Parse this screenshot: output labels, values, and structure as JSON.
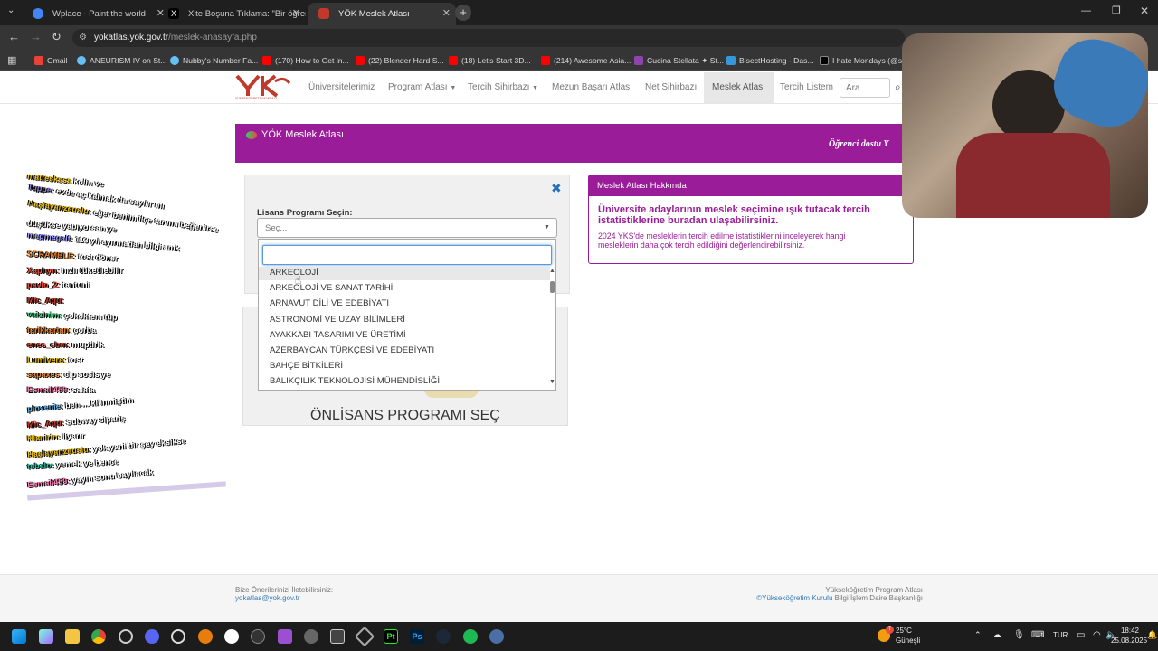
{
  "browser": {
    "tabs": [
      {
        "title": "Wplace - Paint the world",
        "active": false,
        "color": "#4285f4"
      },
      {
        "title": "X'te Boşuna Tıklama: \"Bir öğren",
        "active": false,
        "color": "#000000"
      },
      {
        "title": "YÖK Meslek Atlası",
        "active": true,
        "color": "#c0392b"
      }
    ],
    "url_host": "yokatlas.yok.gov.tr",
    "url_path": "/meslek-anasayfa.php",
    "bookmarks": [
      {
        "label": "Gmail",
        "color": "#ea4335"
      },
      {
        "label": "ANEURISM IV on St...",
        "color": "#1b2838"
      },
      {
        "label": "Nubby's Number Fa...",
        "color": "#1b2838"
      },
      {
        "label": "(170) How to Get in...",
        "color": "#ff0000"
      },
      {
        "label": "(22) Blender Hard S...",
        "color": "#ff0000"
      },
      {
        "label": "(18) Let's Start 3D...",
        "color": "#ff0000"
      },
      {
        "label": "(214) Awesome Asia...",
        "color": "#ff0000"
      },
      {
        "label": "Cucina Stellata ✦ St...",
        "color": "#8e44ad"
      },
      {
        "label": "BisectHosting - Das...",
        "color": "#3498db"
      },
      {
        "label": "I hate Mondays (@s...",
        "color": "#000000"
      }
    ]
  },
  "site": {
    "logo_text": "YÜKSEKÖĞRETİM KURULU",
    "nav": [
      {
        "label": "Üniversitelerimiz",
        "caret": false
      },
      {
        "label": "Program Atlası",
        "caret": true
      },
      {
        "label": "Tercih Sihirbazı",
        "caret": true
      },
      {
        "label": "Mezun Başarı Atlası",
        "caret": false
      },
      {
        "label": "Net Sihirbazı",
        "caret": false
      },
      {
        "label": "Meslek Atlası",
        "caret": false,
        "active": true
      },
      {
        "label": "Tercih Listem",
        "caret": false
      }
    ],
    "search_placeholder": "Ara",
    "banner_title": "YÖK Meslek Atlası",
    "banner_right": "Öğrenci dostu Y",
    "form": {
      "label": "Lisans Programı Seçin:",
      "select_placeholder": "Seç...",
      "options": [
        "ARKEOLOJİ",
        "ARKEOLOJİ VE SANAT TARİHİ",
        "ARNAVUT DİLİ VE EDEBİYATI",
        "ASTRONOMİ VE UZAY BİLİMLERİ",
        "AYAKKABI TASARIMI VE ÜRETİMİ",
        "AZERBAYCAN TÜRKÇESİ VE EDEBİYATI",
        "BAHÇE BİTKİLERİ",
        "BALIKÇILIK TEKNOLOJİSİ MÜHENDİSLİĞİ"
      ],
      "onlisans_label": "ÖNLİSANS PROGRAMI SEÇ"
    },
    "about": {
      "header": "Meslek Atlası Hakkında",
      "headline": "Üniversite adaylarının meslek seçimine ışık tutacak tercih istatistiklerine buradan ulaşabilirsiniz.",
      "body": "2024 YKS'de mesleklerin tercih edilme istatistiklerini inceleyerek hangi mesleklerin daha çok tercih edildiğini değerlendirebilirsiniz."
    },
    "footer": {
      "left_label": "Bize Önerilerinizi İletebilirsiniz:",
      "left_email": "yokatlas@yok.gov.tr",
      "right_line1": "Yükseköğretim Program Atlası",
      "right_link": "©Yükseköğretim Kurulu",
      "right_rest": "Bilgi İşlem Daire Başkanlığı"
    }
  },
  "chat": [
    {
      "user": "mattesksss",
      "msg": "kolin ve",
      "color": "#f1c40f"
    },
    {
      "user": "Tuppe:",
      "msg": "evde aç kalmak da sayılır mı",
      "color": "#8e7cc3"
    },
    {
      "user": "Haşlayanzeuslu:",
      "msg": "eğer benim ilçe tanımı beğenirse",
      "color": "#e6b800"
    },
    {
      "user": "",
      "msg": "düşükse yapıyorsan ye",
      "color": "#ffffff"
    },
    {
      "user": "megmegalf:",
      "msg": "113 yıl ayırmadan bilgi amk",
      "color": "#a0a0ff"
    },
    {
      "user": "SCRAMBLE:",
      "msg": "tost döner",
      "color": "#e67e22"
    },
    {
      "user": "Xaphyn:",
      "msg": "hızlı tüketilebilir",
      "color": "#e74c3c"
    },
    {
      "user": "pavlo_2:",
      "msg": "tantuni",
      "color": "#e74c3c"
    },
    {
      "user": "Mic_Aqu:",
      "msg": "",
      "color": "#c0392b"
    },
    {
      "user": "vaizinim:",
      "msg": "çokoktem tüp",
      "color": "#2ecc71"
    },
    {
      "user": "tarikkartan:",
      "msg": "çorba",
      "color": "#e67e22"
    },
    {
      "user": "enes_cbm:",
      "msg": "muptirik",
      "color": "#c0392b"
    },
    {
      "user": "Lumivera:",
      "msg": "tost",
      "color": "#e6b800"
    },
    {
      "user": "sapaxes:",
      "msg": "cip sosis ye",
      "color": "#e67e22"
    },
    {
      "user": "Esmail459:",
      "msg": "salata",
      "color": "#ff7eb6"
    },
    {
      "user": "plovenie:",
      "msg": "ben ... kilinmiştim",
      "color": "#5dade2"
    },
    {
      "user": "Mic_Aqu:",
      "msg": "Subway sipariş",
      "color": "#c0392b"
    },
    {
      "user": "Hlanirin:",
      "msg": "liyarır",
      "color": "#e6b800"
    },
    {
      "user": "Haşlayanzeuslu:",
      "msg": "yok yani bir şey eksikse",
      "color": "#e6b800"
    },
    {
      "user": "tebalo:",
      "msg": "yemek ye bence",
      "color": "#1abc9c"
    },
    {
      "user": "Esmail459:",
      "msg": "yayın sonu bayılacak",
      "color": "#ff7eb6"
    },
    {
      "user": "",
      "msg": "",
      "color": "#9b59b6"
    }
  ],
  "taskbar": {
    "weather_temp": "25°C",
    "weather_desc": "Güneşli",
    "weather_badge": "7",
    "lang": "TUR",
    "time": "18:42",
    "date": "25.08.2025"
  }
}
